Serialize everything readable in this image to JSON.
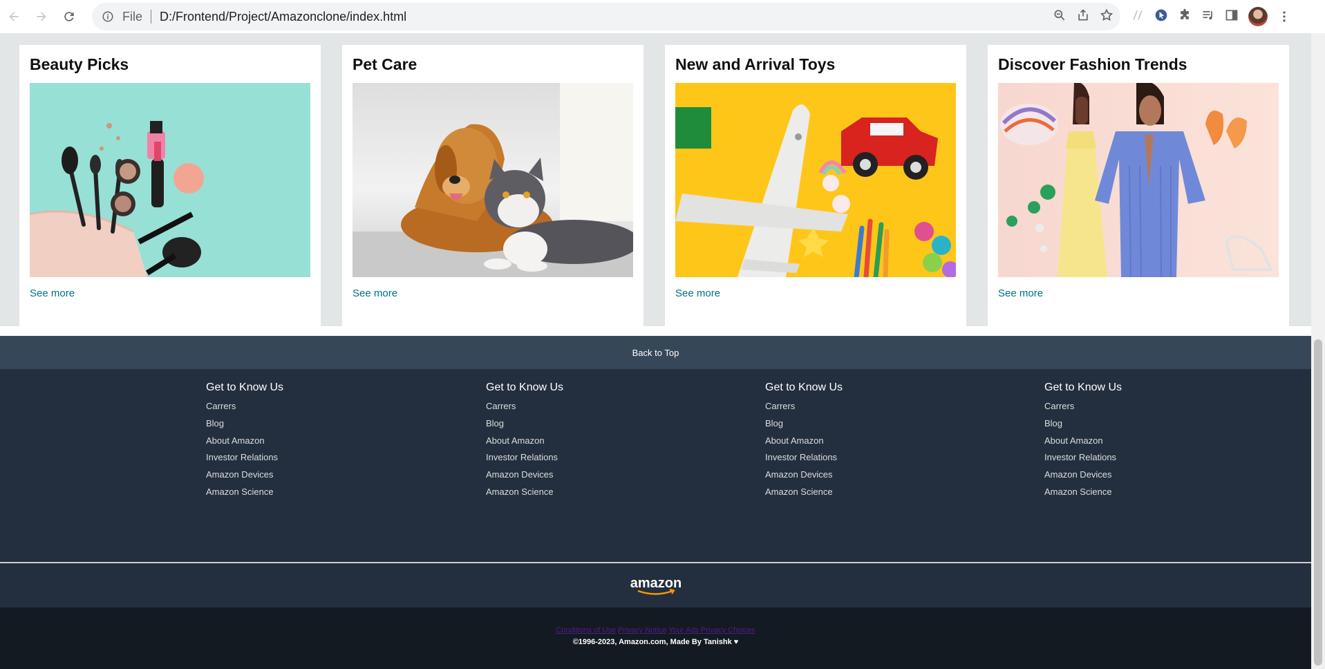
{
  "browser": {
    "protocol_label": "File",
    "url": "D:/Frontend/Project/Amazonclone/index.html"
  },
  "cards": [
    {
      "title": "Beauty Picks",
      "link": "See more"
    },
    {
      "title": "Pet Care",
      "link": "See more"
    },
    {
      "title": "New and Arrival Toys",
      "link": "See more"
    },
    {
      "title": "Discover Fashion Trends",
      "link": "See more"
    }
  ],
  "footer": {
    "back_to_top": "Back to Top",
    "columns": [
      {
        "heading": "Get to Know Us",
        "links": [
          "Carrers",
          "Blog",
          "About Amazon",
          "Investor Relations",
          "Amazon Devices",
          "Amazon Science"
        ]
      },
      {
        "heading": "Get to Know Us",
        "links": [
          "Carrers",
          "Blog",
          "About Amazon",
          "Investor Relations",
          "Amazon Devices",
          "Amazon Science"
        ]
      },
      {
        "heading": "Get to Know Us",
        "links": [
          "Carrers",
          "Blog",
          "About Amazon",
          "Investor Relations",
          "Amazon Devices",
          "Amazon Science"
        ]
      },
      {
        "heading": "Get to Know Us",
        "links": [
          "Carrers",
          "Blog",
          "About Amazon",
          "Investor Relations",
          "Amazon Devices",
          "Amazon Science"
        ]
      }
    ],
    "logo_text": "amazon",
    "legal_links": [
      "Conditions of Use",
      "Privacy Notice",
      "Your Ads Privacy Choices"
    ],
    "copyright": "©1996-2023, Amazon.com, Made By Tanishk ♥"
  },
  "colors": {
    "link": "#007185",
    "back_to_top_bg": "#37475a",
    "footer_bg": "#232f3e",
    "footer_bottom_bg": "#131a22",
    "page_bg": "#e3e6e6"
  }
}
